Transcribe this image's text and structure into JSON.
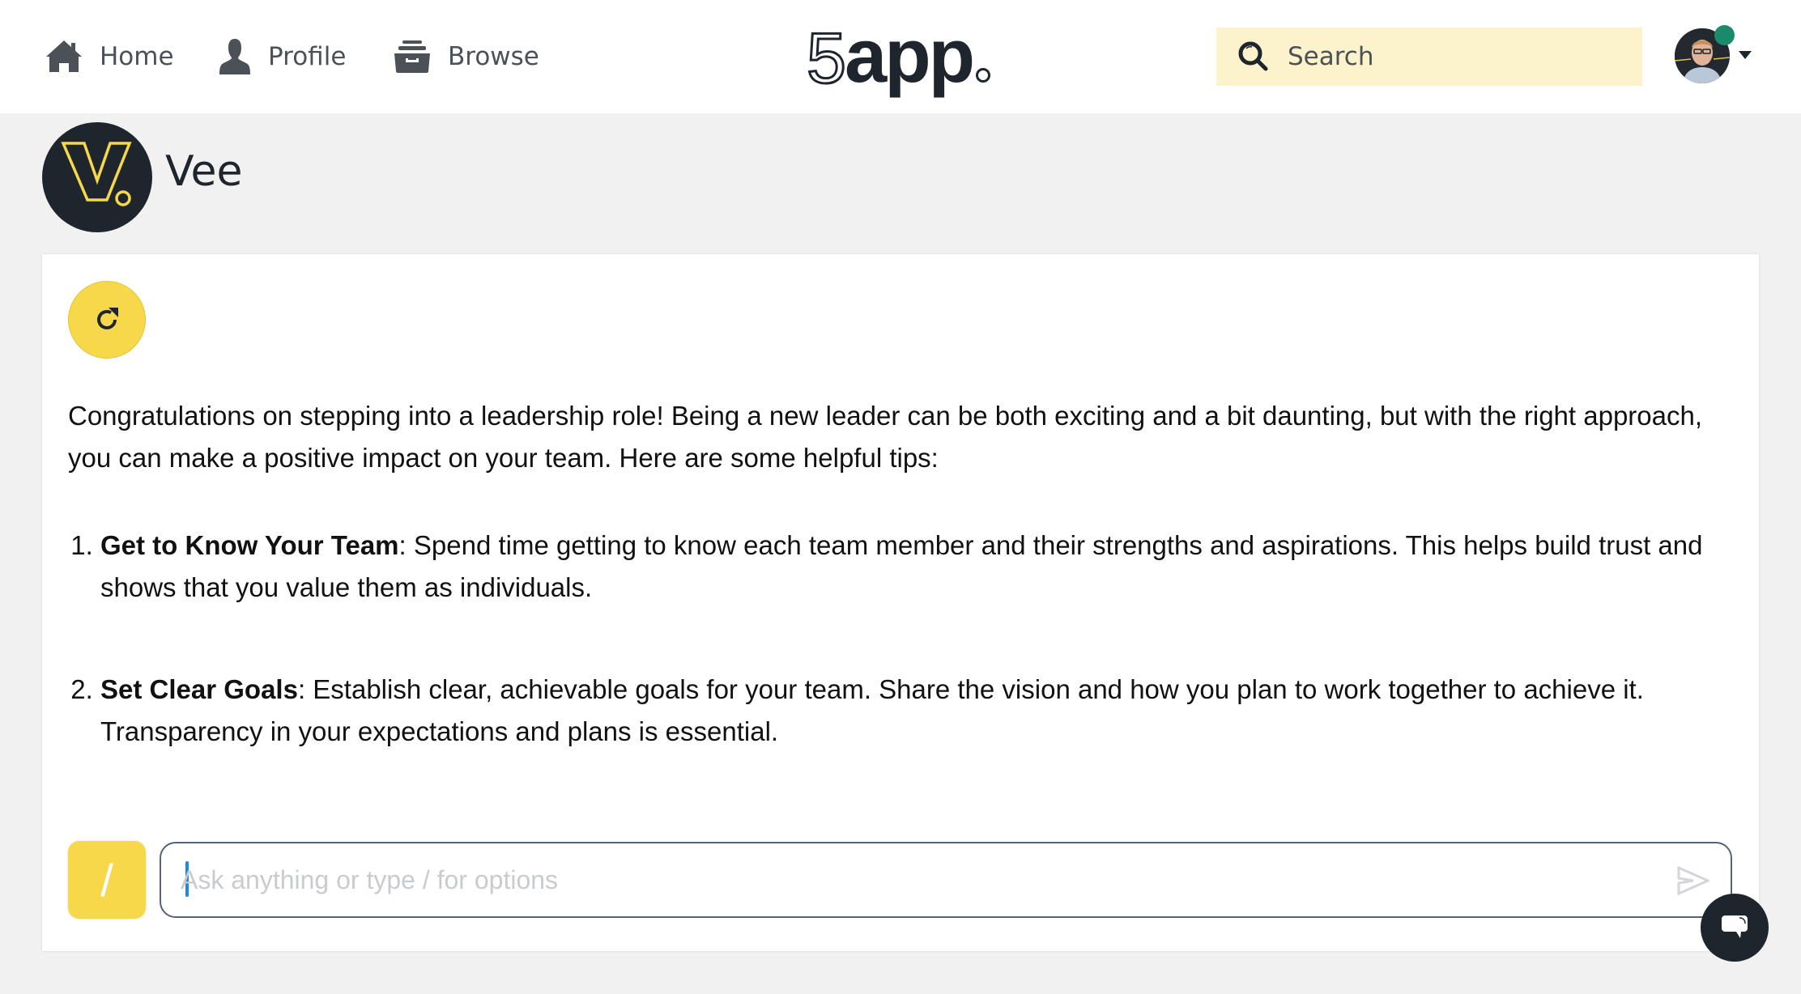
{
  "header": {
    "nav": [
      {
        "label": "Home",
        "icon": "home-icon"
      },
      {
        "label": "Profile",
        "icon": "user-icon"
      },
      {
        "label": "Browse",
        "icon": "archive-icon"
      }
    ],
    "logo": {
      "five": "5",
      "app": "app"
    },
    "search": {
      "label": "Search",
      "icon": "search-icon"
    },
    "user": {
      "presence": "online",
      "presence_color": "#1a8a6a"
    }
  },
  "assistant": {
    "name": "Vee",
    "logo_letter": "V"
  },
  "conversation": {
    "intro": "Congratulations on stepping into a leadership role! Being a new leader can be both exciting and a bit daunting, but with the right approach, you can make a positive impact on your team. Here are some helpful tips:",
    "tips": [
      {
        "title": "Get to Know Your Team",
        "body": ": Spend time getting to know each team member and their strengths and aspirations. This helps build trust and shows that you value them as individuals."
      },
      {
        "title": "Set Clear Goals",
        "body": ": Establish clear, achievable goals for your team. Share the vision and how you plan to work together to achieve it. Transparency in your expectations and plans is essential."
      }
    ]
  },
  "composer": {
    "slash_label": "/",
    "placeholder": "Ask anything or type / for options",
    "value": ""
  },
  "colors": {
    "accent": "#f6d84a",
    "dark": "#1f252c",
    "search_bg": "#fcf2cc",
    "page_bg": "#f1f1f1"
  }
}
